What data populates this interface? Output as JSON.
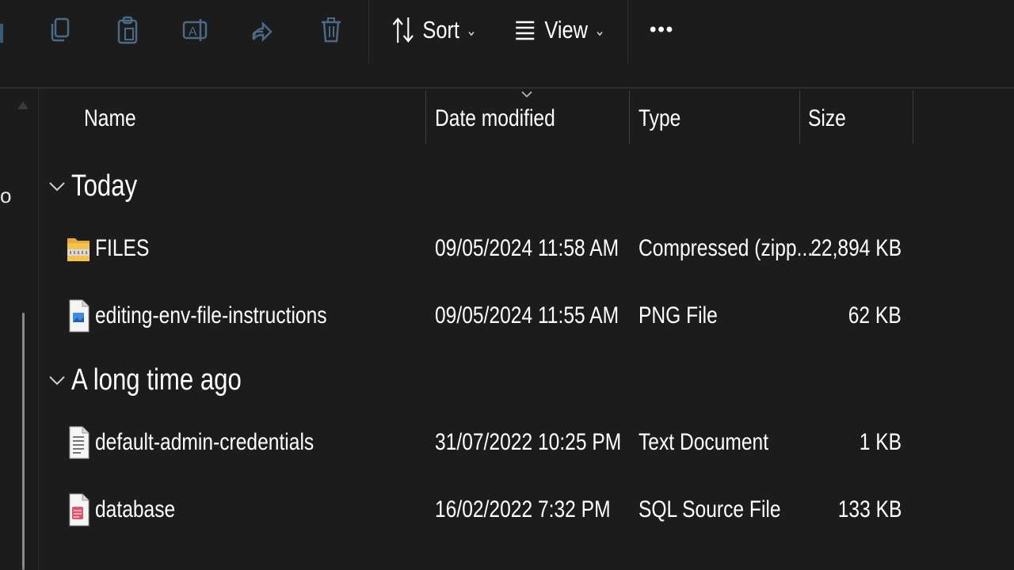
{
  "toolbar": {
    "icons": [
      "copy-icon",
      "paste-icon",
      "rename-icon",
      "share-icon",
      "delete-icon"
    ],
    "sort_label": "Sort",
    "view_label": "View",
    "more_label": "•••"
  },
  "nav": {
    "cut_label": "o"
  },
  "columns": {
    "name": "Name",
    "date": "Date modified",
    "type": "Type",
    "size": "Size"
  },
  "groups": [
    {
      "title": "Today",
      "files": [
        {
          "name": "FILES",
          "date": "09/05/2024 11:58 AM",
          "type": "Compressed (zipp...",
          "size": "22,894 KB",
          "icon": "zip-folder-icon"
        },
        {
          "name": "editing-env-file-instructions",
          "date": "09/05/2024 11:55 AM",
          "type": "PNG File",
          "size": "62 KB",
          "icon": "image-file-icon"
        }
      ]
    },
    {
      "title": "A long time ago",
      "files": [
        {
          "name": "default-admin-credentials",
          "date": "31/07/2022 10:25 PM",
          "type": "Text Document",
          "size": "1 KB",
          "icon": "text-file-icon"
        },
        {
          "name": "database",
          "date": "16/02/2022 7:32 PM",
          "type": "SQL Source File",
          "size": "133 KB",
          "icon": "sql-file-icon"
        }
      ]
    }
  ],
  "colors": {
    "background": "#1c1c1c",
    "text": "#ffffff",
    "disabled_icon": "#4a6a86",
    "folder": "#f2c14e",
    "sql": "#d9566b"
  }
}
